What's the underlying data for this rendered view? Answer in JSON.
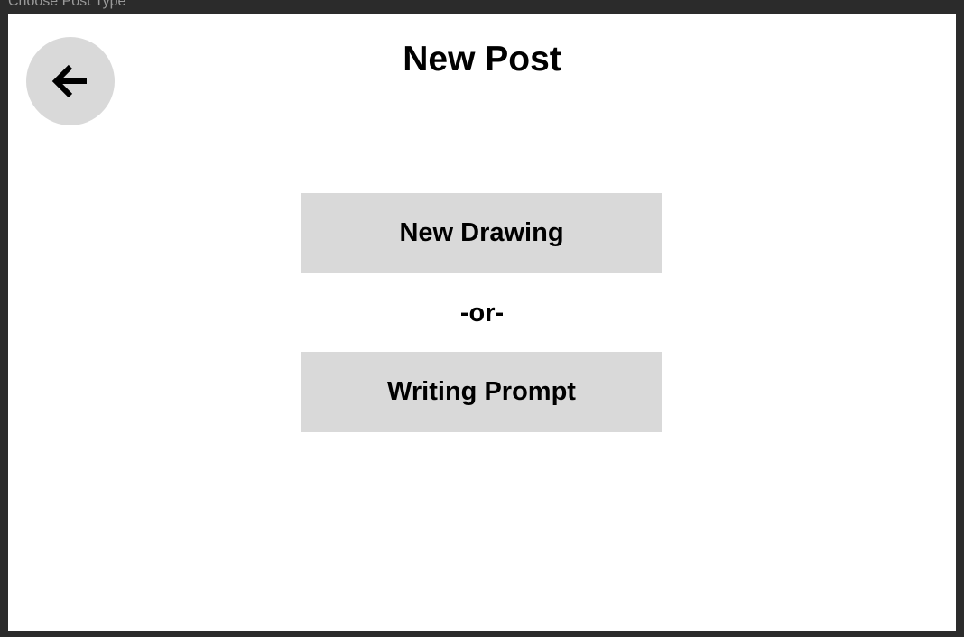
{
  "window": {
    "frame_label": "Choose Post Type"
  },
  "header": {
    "title": "New Post",
    "back_icon": "arrow-left-icon"
  },
  "options": {
    "drawing_label": "New Drawing",
    "divider_text": "-or-",
    "writing_label": "Writing Prompt"
  },
  "colors": {
    "background": "#ffffff",
    "button_fill": "#d9d9d9",
    "text": "#000000",
    "outer": "#2b2b2b"
  }
}
